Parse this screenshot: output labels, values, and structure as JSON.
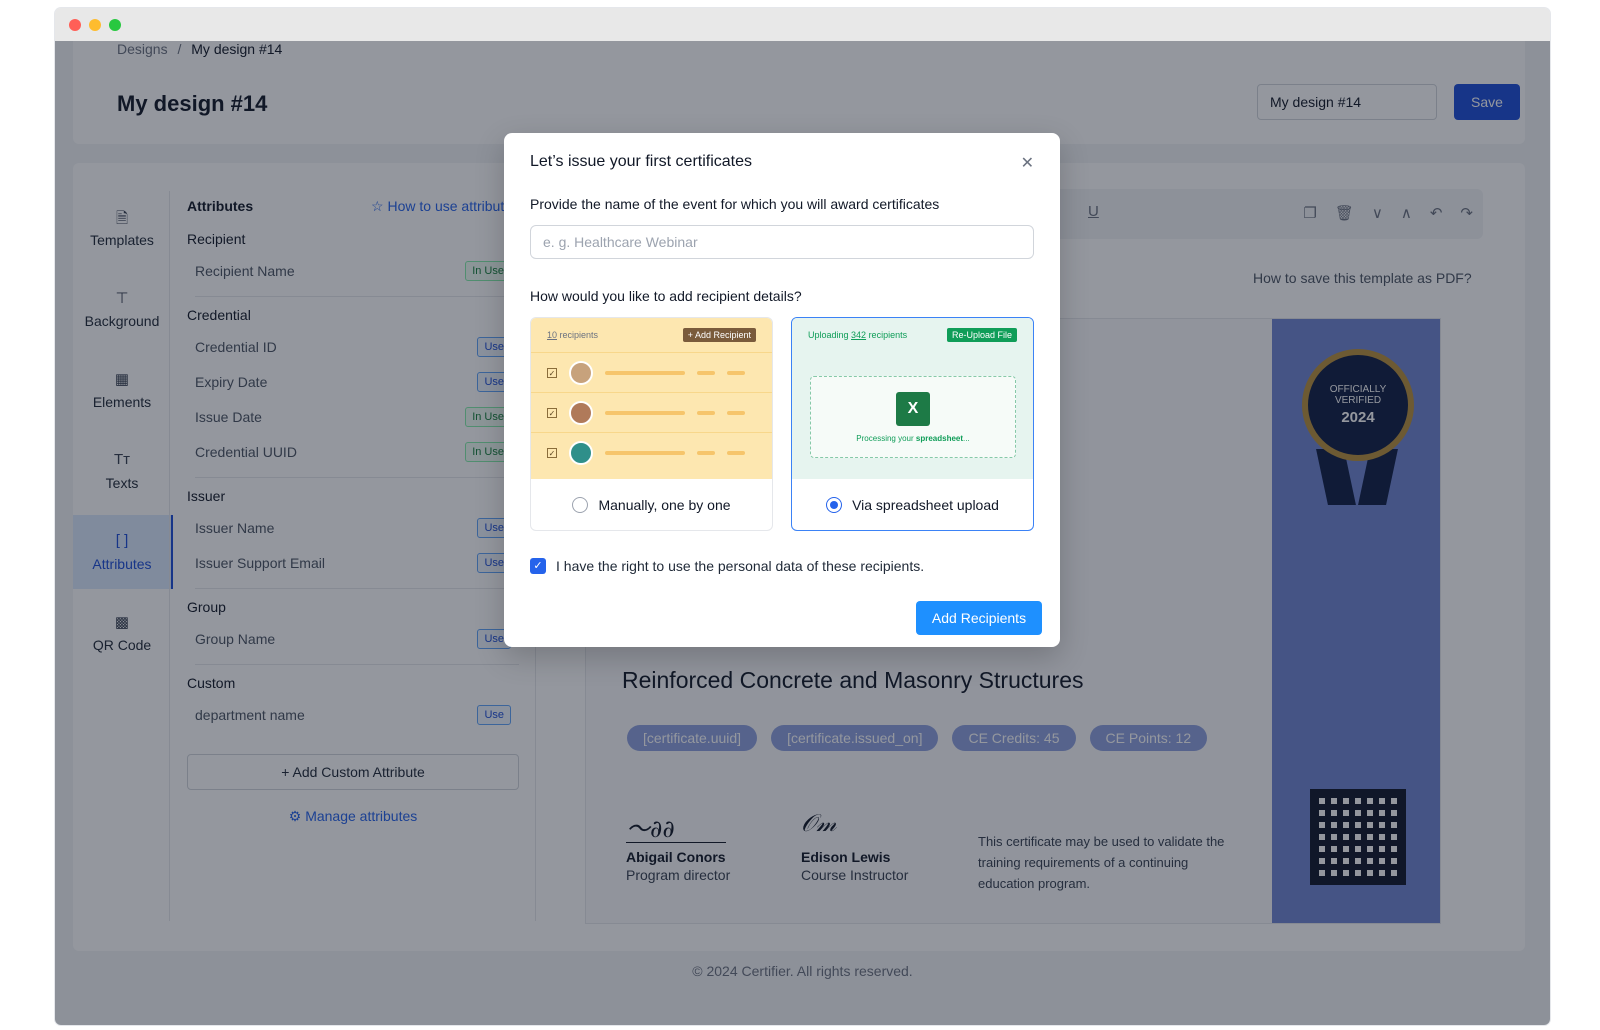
{
  "breadcrumb": {
    "root": "Designs",
    "separator": "/",
    "current": "My design #14"
  },
  "header": {
    "title": "My design #14",
    "name_value": "My design #14",
    "save_label": "Save"
  },
  "sidenav": {
    "items": [
      {
        "label": "Templates",
        "icon": "document-icon",
        "glyph": "🗎"
      },
      {
        "label": "Background",
        "icon": "paint-roller-icon",
        "glyph": "⊤"
      },
      {
        "label": "Elements",
        "icon": "grid-icon",
        "glyph": "▦"
      },
      {
        "label": "Texts",
        "icon": "text-icon",
        "glyph": "Tт"
      },
      {
        "label": "Attributes",
        "icon": "brackets-icon",
        "glyph": "[ ]"
      },
      {
        "label": "QR Code",
        "icon": "qr-icon",
        "glyph": "▩"
      }
    ]
  },
  "attributes": {
    "title": "Attributes",
    "help_link": "How to use attributes",
    "sections": [
      {
        "title": "Recipient",
        "items": [
          {
            "name": "Recipient Name",
            "status": "In Use"
          }
        ]
      },
      {
        "title": "Credential",
        "items": [
          {
            "name": "Credential ID",
            "status": "Use"
          },
          {
            "name": "Expiry Date",
            "status": "Use"
          },
          {
            "name": "Issue Date",
            "status": "In Use"
          },
          {
            "name": "Credential UUID",
            "status": "In Use"
          }
        ]
      },
      {
        "title": "Issuer",
        "items": [
          {
            "name": "Issuer Name",
            "status": "Use"
          },
          {
            "name": "Issuer Support Email",
            "status": "Use"
          }
        ]
      },
      {
        "title": "Group",
        "items": [
          {
            "name": "Group Name",
            "status": "Use"
          }
        ]
      },
      {
        "title": "Custom",
        "items": [
          {
            "name": "department name",
            "status": "Use"
          }
        ]
      }
    ],
    "add_custom": "+ Add Custom Attribute",
    "manage": "Manage attributes"
  },
  "toolbar": {
    "pdf_link": "How to save this template as PDF?"
  },
  "certificate": {
    "seal": {
      "line1": "OFFICIALLY",
      "line2": "VERIFIED",
      "year": "2024"
    },
    "course": "Reinforced Concrete and Masonry Structures",
    "chips": [
      "[certificate.uuid]",
      "[certificate.issued_on]",
      "CE Credits: 45",
      "CE Points: 12"
    ],
    "signers": [
      {
        "name": "Abigail Conors",
        "role": "Program director"
      },
      {
        "name": "Edison Lewis",
        "role": "Course Instructor"
      }
    ],
    "note": "This certificate may be used to validate the training requirements of a continuing education program."
  },
  "footer": {
    "text": "© 2024 Certifier. All rights reserved."
  },
  "dialog": {
    "title": "Let’s issue your first certificates",
    "event_question": "Provide the name of the event for which you will award certificates",
    "event_placeholder": "e. g. Healthcare Webinar",
    "method_question": "How would you like to add recipient details?",
    "manual": {
      "count": "10",
      "count_suffix": " recipients",
      "button": "+ Add Recipient",
      "label": "Manually, one by one",
      "selected": false
    },
    "upload": {
      "prefix": "Uploading ",
      "count": "342",
      "count_suffix": " recipients",
      "button": "Re-Upload File",
      "processing_prefix": "Processing your ",
      "processing_word": "spreadsheet",
      "processing_suffix": "...",
      "label": "Via spreadsheet upload",
      "selected": true
    },
    "consent": "I have the right to use the personal data of these recipients.",
    "consent_checked": true,
    "submit": "Add Recipients"
  }
}
